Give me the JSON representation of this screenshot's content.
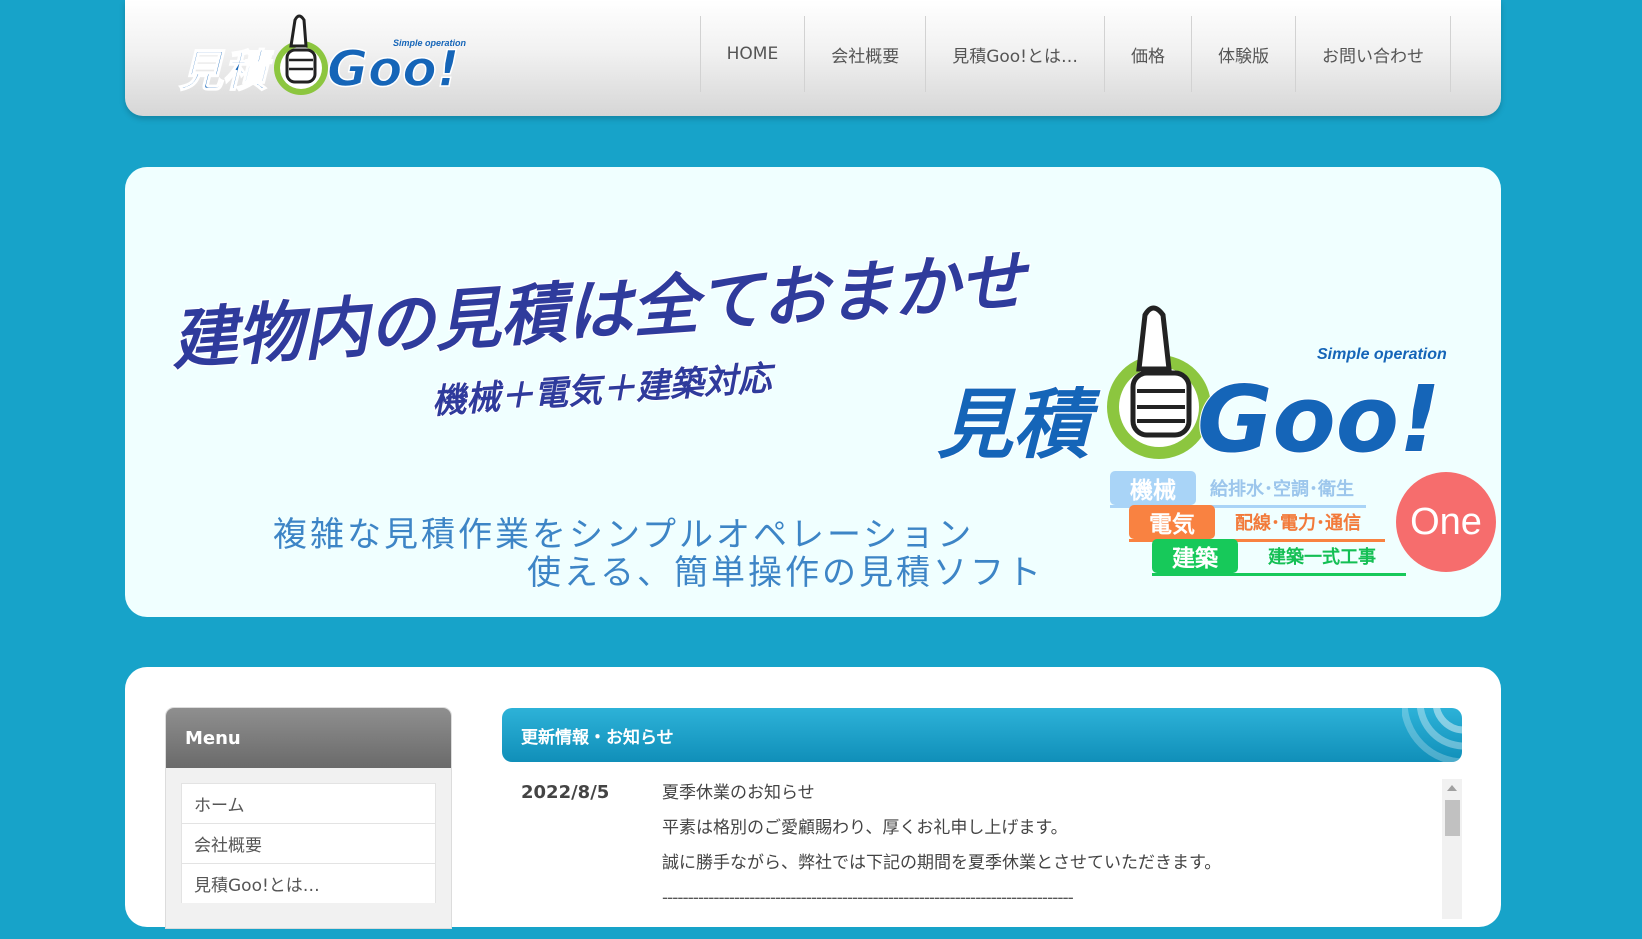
{
  "header": {
    "logo": {
      "main_text": "見積",
      "goo_text": "Goo!",
      "tagline": "Simple operation"
    },
    "nav": [
      "HOME",
      "会社概要",
      "見積Goo!とは…",
      "価格",
      "体験版",
      "お問い合わせ"
    ]
  },
  "hero": {
    "headline": "建物内の見積は全ておまかせ",
    "subheadline": "機械＋電気＋建築対応",
    "logo": {
      "main_text": "見積",
      "goo_text": "Goo!",
      "tagline": "Simple operation"
    },
    "sub_line1": "複雑な見積作業をシンプルオペレーション",
    "sub_line2": "使える、簡単操作の見積ソフト",
    "categories": [
      {
        "label": "機械",
        "desc": "給排水･空調･衛生",
        "color": "#a9d4f7",
        "desc_color": "#9cc6ec"
      },
      {
        "label": "電気",
        "desc": "配線･電力･通信",
        "color": "#f98241",
        "desc_color": "#f27a3a"
      },
      {
        "label": "建築",
        "desc": "建築一式工事",
        "color": "#17c95a",
        "desc_color": "#14bf54"
      }
    ],
    "one_badge": "One",
    "colors": {
      "headline": "#2f3b9c",
      "sub": "#3d85c6",
      "one": "#f66d6d"
    }
  },
  "menu": {
    "title": "Menu",
    "items": [
      "ホーム",
      "会社概要",
      "見積Goo!とは…"
    ]
  },
  "news": {
    "title": "更新情報・お知らせ",
    "date": "2022/8/5",
    "lines": [
      "夏季休業のお知らせ",
      "平素は格別のご愛顧賜わり、厚くお礼申し上げます。",
      "誠に勝手ながら、弊社では下記の期間を夏季休業とさせていただきます。",
      "--------------------------------------------------------------------------------"
    ]
  },
  "colors": {
    "background": "#17a3c9",
    "accent": "#1a9ccb",
    "logo_blue": "#1565b8",
    "logo_green": "#8cc63f"
  }
}
